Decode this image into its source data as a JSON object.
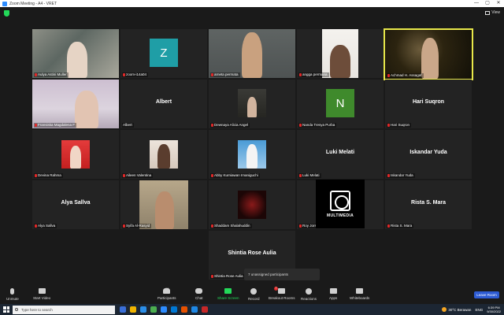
{
  "window": {
    "title": "Zoom Meeting - A4 - VRET",
    "controls": [
      "—",
      "▢",
      "✕"
    ]
  },
  "topbar": {
    "view_label": "View"
  },
  "tiles": [
    {
      "name": "Aulya Astini Muller"
    },
    {
      "name": "zoom-i14a04",
      "initial": "Z"
    },
    {
      "name": "arneta permata"
    },
    {
      "name": "angga permana"
    },
    {
      "name": "Achmad H. Assagaf"
    },
    {
      "name": "Fransiska Magdalena F"
    },
    {
      "name": "Albert",
      "big_name": "Albert"
    },
    {
      "name": "Dewnaya Alicia Angel"
    },
    {
      "name": "Nanda Tresya Purba",
      "initial": "N"
    },
    {
      "name": "Hari Suqron",
      "big_name": "Hari Suqron"
    },
    {
      "name": "Devina Rahma"
    },
    {
      "name": "Aileen Valentina"
    },
    {
      "name": "Abby Kurniawan Imaniguchi"
    },
    {
      "name": "Luki Melati",
      "big_name": "Luki Melati"
    },
    {
      "name": "Iskandar Yuda",
      "big_name": "Iskandar Yuda"
    },
    {
      "name": "Alya Sallva",
      "big_name": "Alya Sallva"
    },
    {
      "name": "Syifa Al-Rasyid"
    },
    {
      "name": "Shaddam Shalahuddin"
    },
    {
      "name": "Roy Jorsin",
      "logo_text": "MULTIMEDIA"
    },
    {
      "name": "Rista S. Mara",
      "big_name": "Rista S. Mara"
    },
    {
      "name": "Shintia Rose Aulia",
      "big_name": "Shintia Rose Aulia"
    }
  ],
  "toast": "7 unassigned participants",
  "toolbar": {
    "unmute": "Unmute",
    "start_video": "Start Video",
    "participants": "Participants",
    "participants_count": "25",
    "chat": "Chat",
    "share_screen": "Share Screen",
    "record": "Record",
    "breakout_rooms": "Breakout Rooms",
    "breakout_badge": "7",
    "reactions": "Reactions",
    "apps": "Apps",
    "whiteboards": "Whiteboards",
    "leave": "Leave Room"
  },
  "taskbar": {
    "search_placeholder": "Type here to search",
    "weather": "30°C  Berawan",
    "time": "6:39 PM",
    "date": "9/30/2022",
    "lang": "ENG"
  },
  "colors": {
    "accent": "#2d8cff",
    "share_green": "#23d959",
    "mic_red": "#e02828",
    "active_speaker": "#e8e84a",
    "teal_avatar": "#1f9ea6",
    "green_avatar": "#3f8a2c"
  }
}
